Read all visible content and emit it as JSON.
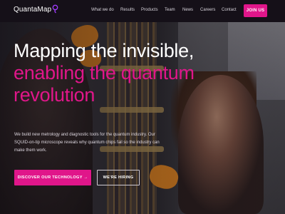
{
  "navbar": {
    "logo_text": "QuantaMap",
    "logo_icon": "quantamap-q-mark-icon",
    "links": [
      "What we do",
      "Results",
      "Products",
      "Team",
      "News",
      "Careers",
      "Contact"
    ],
    "cta_label": "JOIN US"
  },
  "hero": {
    "headline_line1": "Mapping the invisible,",
    "headline_line2": "enabling the quantum",
    "headline_line3": "revolution",
    "subtext": "We build new metrology and diagnostic tools for the quantum industry. Our SQUID-on-tip microscope reveals why quantum chips fail so the industry can make them work.",
    "primary_cta": "DISCOVER OUR TECHNOLOGY →",
    "secondary_cta": "WE'RE HIRING"
  },
  "colors": {
    "accent": "#e0168a",
    "navbar_bg": "#151018",
    "text": "#ffffff"
  }
}
